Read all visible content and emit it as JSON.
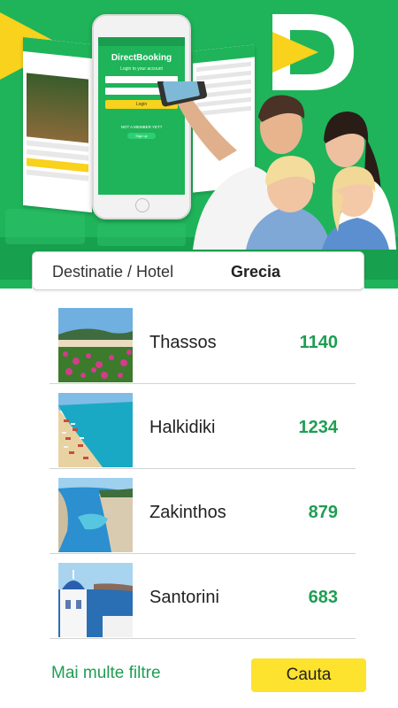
{
  "hero": {
    "app_brand": "DirectBooking",
    "phone_login_hint": "Login to your account",
    "phone_login_button": "Login",
    "phone_not_member": "NOT A MEMBER YET?",
    "phone_signup": "Sign up",
    "logo_letter": "D",
    "colors": {
      "brand_green": "#1fb45a",
      "accent_yellow": "#f8d21c"
    }
  },
  "search": {
    "label": "Destinatie / Hotel",
    "value": "Grecia"
  },
  "results": [
    {
      "name": "Thassos",
      "count": "1140",
      "image": "beach-flowers-photo"
    },
    {
      "name": "Halkidiki",
      "count": "1234",
      "image": "crowded-beach-photo"
    },
    {
      "name": "Zakinthos",
      "count": "879",
      "image": "navagio-cove-photo"
    },
    {
      "name": "Santorini",
      "count": "683",
      "image": "santorini-dome-photo"
    }
  ],
  "footer": {
    "more_filters": "Mai multe filtre",
    "search_button": "Cauta"
  }
}
